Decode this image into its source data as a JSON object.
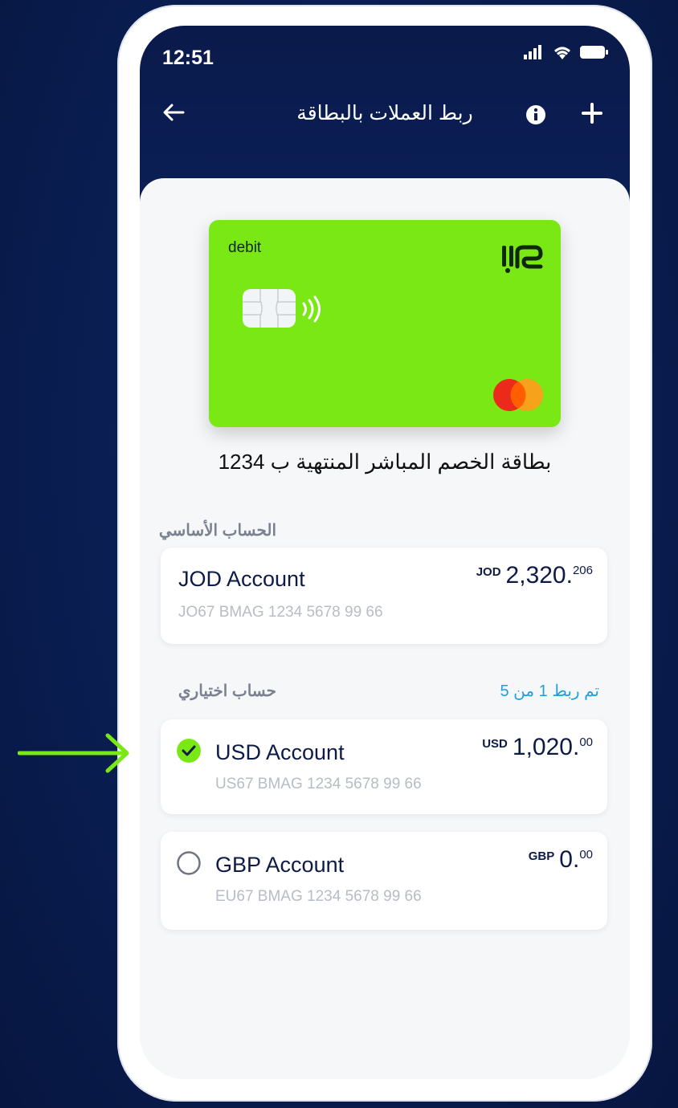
{
  "status_bar": {
    "time": "12:51"
  },
  "header": {
    "title": "ربط العملات بالبطاقة"
  },
  "card": {
    "type_label": "debit",
    "caption": "بطاقة الخصم المباشر المنتهية ب 1234"
  },
  "primary_section": {
    "label": "الحساب الأساسي"
  },
  "optional_section": {
    "label": "حساب اختياري",
    "linked_count": "تم ربط 1 من 5"
  },
  "accounts": [
    {
      "name": "JOD Account",
      "iban": "JO67 BMAG 1234 5678 99 66",
      "currency": "JOD",
      "amount_main": "2,320.",
      "amount_frac": "206"
    },
    {
      "name": "USD Account",
      "iban": "US67 BMAG 1234 5678 99 66",
      "currency": "USD",
      "amount_main": "1,020.",
      "amount_frac": "00",
      "selected": true
    },
    {
      "name": "GBP Account",
      "iban": "EU67 BMAG 1234 5678 99 66",
      "currency": "GBP",
      "amount_main": "0.",
      "amount_frac": "00",
      "selected": false
    }
  ],
  "colors": {
    "accent_green": "#79e815",
    "header_navy": "#0b1f58",
    "link_blue": "#1ea0e0"
  },
  "icons": [
    "back-arrow-icon",
    "info-icon",
    "plus-icon",
    "signal-icon",
    "wifi-icon",
    "battery-icon",
    "contactless-icon",
    "mastercard-logo",
    "check-icon",
    "radio-empty-icon",
    "pointer-arrow-icon"
  ]
}
